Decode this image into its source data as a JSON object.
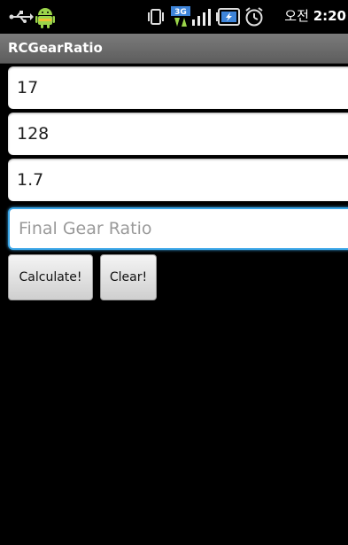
{
  "status_bar": {
    "clock_prefix": "오전",
    "clock_time": "2:20",
    "icons": [
      "usb-icon",
      "android-icon",
      "vibrate-icon",
      "3g-network-icon",
      "signal-icon",
      "battery-icon",
      "alarm-icon"
    ]
  },
  "app": {
    "title": "RCGearRatio"
  },
  "fields": {
    "field1_value": "17",
    "field2_value": "128",
    "field3_value": "1.7",
    "result_placeholder": "Final Gear Ratio"
  },
  "buttons": {
    "calculate_label": "Calculate!",
    "clear_label": "Clear!"
  },
  "colors": {
    "title_bar": "#6e6e6e",
    "focus_border": "#3aa6e8",
    "background": "#000000"
  }
}
